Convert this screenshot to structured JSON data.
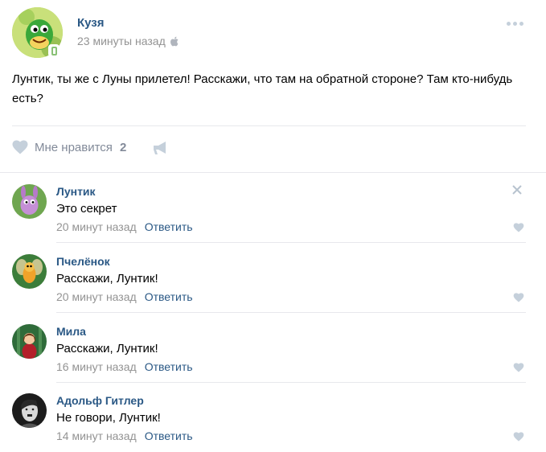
{
  "post": {
    "author": "Кузя",
    "time": "23 минуты назад",
    "text": "Лунтик, ты же с Луны прилетел! Расскажи, что там на обратной стороне? Там кто-нибудь есть?",
    "like_label": "Мне нравится",
    "like_count": "2",
    "icons": [
      "online-mobile-icon",
      "apple-icon",
      "more-icon",
      "heart-icon",
      "megaphone-icon"
    ]
  },
  "comments": [
    {
      "name": "Лунтик",
      "text": "Это секрет",
      "time": "20 минут назад",
      "reply": "Ответить"
    },
    {
      "name": "Пчелёнок",
      "text": "Расскажи, Лунтик!",
      "time": "20 минут назад",
      "reply": "Ответить"
    },
    {
      "name": "Мила",
      "text": "Расскажи, Лунтик!",
      "time": "16 минут назад",
      "reply": "Ответить"
    },
    {
      "name": "Адольф Гитлер",
      "text": "Не говори, Лунтик!",
      "time": "14 минут назад",
      "reply": "Ответить"
    }
  ],
  "colors": {
    "link": "#2a5885",
    "meta": "#939393",
    "icon": "#c5d0db",
    "separator": "#e7e8ec"
  }
}
